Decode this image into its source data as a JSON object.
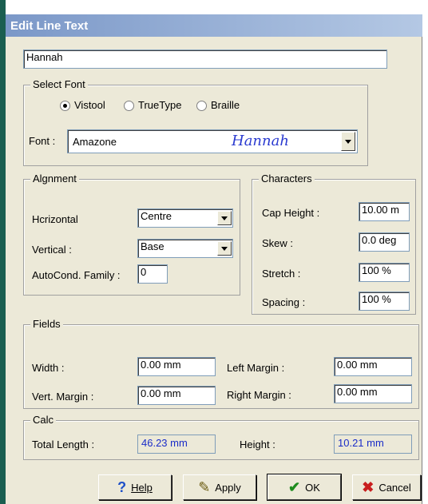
{
  "window": {
    "title": "Edit Line Text"
  },
  "text_input": {
    "value": "Hannah"
  },
  "select_font": {
    "legend": "Select Font",
    "radios": [
      {
        "label": "Vistool",
        "checked": true
      },
      {
        "label": "TrueType",
        "checked": false
      },
      {
        "label": "Braille",
        "checked": false
      }
    ],
    "font_label": "Font :",
    "font_name": "Amazone",
    "font_preview": "Hannah"
  },
  "alignment": {
    "legend": "Algnment",
    "horizontal_label": "Hcrizontal",
    "horizontal_value": "Centre",
    "vertical_label": "Vertical :",
    "vertical_value": "Base",
    "autocond_label": "AutoCond. Family :",
    "autocond_value": "0"
  },
  "characters": {
    "legend": "Characters",
    "cap_height_label": "Cap Height :",
    "cap_height_value": "10.00 m",
    "skew_label": "Skew :",
    "skew_value": "0.0 deg",
    "stretch_label": "Stretch :",
    "stretch_value": "100 %",
    "spacing_label": "Spacing :",
    "spacing_value": "100 %"
  },
  "fields": {
    "legend": "Fields",
    "width_label": "Width :",
    "width_value": "0.00 mm",
    "left_margin_label": "Left Margin :",
    "left_margin_value": "0.00 mm",
    "vert_margin_label": "Vert. Margin :",
    "vert_margin_value": "0.00 mm",
    "right_margin_label": "Right Margin :",
    "right_margin_value": "0.00 mm"
  },
  "calc": {
    "legend": "Calc",
    "total_length_label": "Total Length :",
    "total_length_value": "46.23 mm",
    "height_label": "Height :",
    "height_value": "10.21 mm"
  },
  "buttons": {
    "help": "Help",
    "apply": "Apply",
    "ok": "OK",
    "cancel": "Cancel"
  },
  "colors": {
    "readout_text": "#1a2cc8",
    "preview_text": "#2a3ad0",
    "cancel_icon": "#c81e1e",
    "ok_icon": "#1e8c1e",
    "help_icon": "#1e50c8"
  }
}
